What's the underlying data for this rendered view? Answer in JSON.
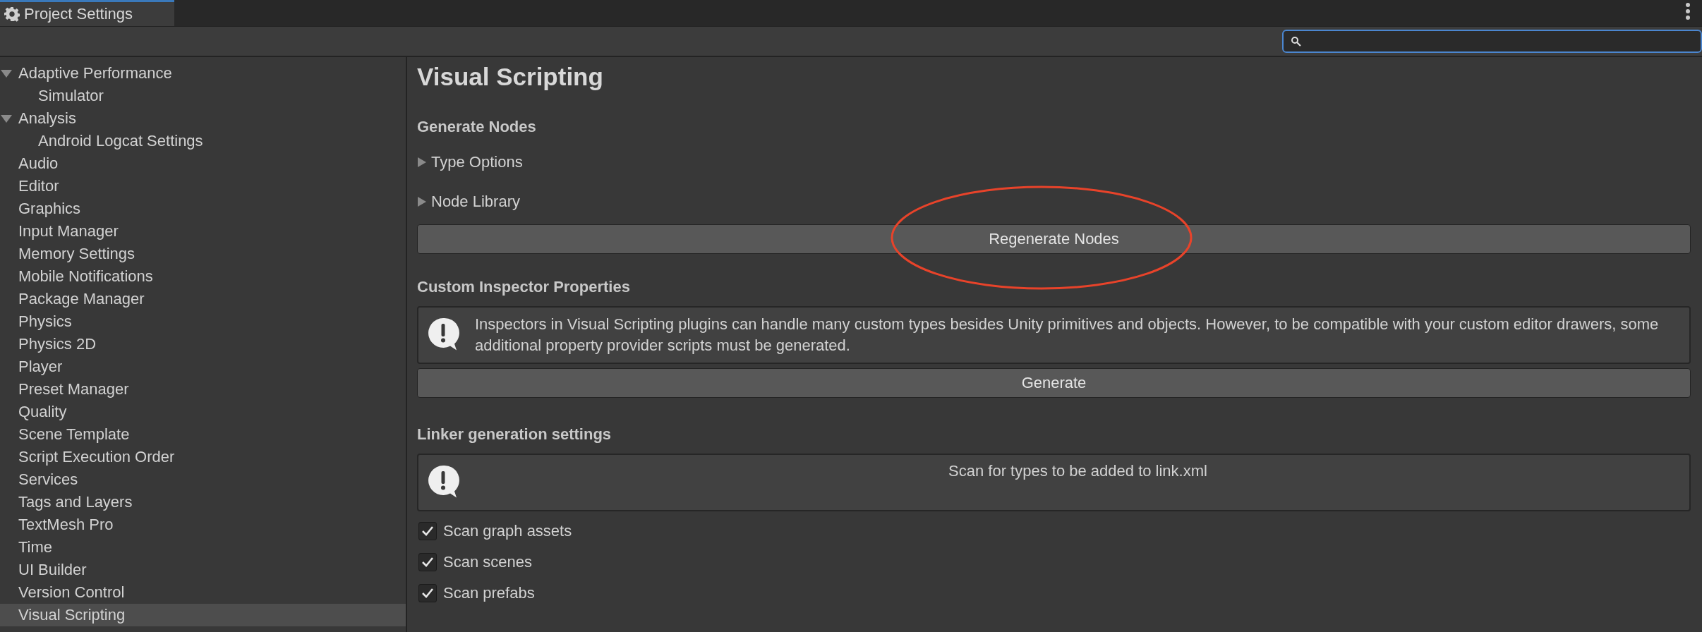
{
  "window": {
    "title": "Project Settings"
  },
  "search": {
    "focused": true
  },
  "sidebar": {
    "items": [
      {
        "label": "Adaptive Performance",
        "selected": false,
        "expanded": true,
        "children": [
          {
            "label": "Simulator",
            "selected": false
          }
        ]
      },
      {
        "label": "Analysis",
        "selected": false,
        "expanded": true,
        "children": [
          {
            "label": "Android Logcat Settings",
            "selected": false
          }
        ]
      },
      {
        "label": "Audio",
        "selected": false
      },
      {
        "label": "Editor",
        "selected": false
      },
      {
        "label": "Graphics",
        "selected": false
      },
      {
        "label": "Input Manager",
        "selected": false
      },
      {
        "label": "Memory Settings",
        "selected": false
      },
      {
        "label": "Mobile Notifications",
        "selected": false
      },
      {
        "label": "Package Manager",
        "selected": false
      },
      {
        "label": "Physics",
        "selected": false
      },
      {
        "label": "Physics 2D",
        "selected": false
      },
      {
        "label": "Player",
        "selected": false
      },
      {
        "label": "Preset Manager",
        "selected": false
      },
      {
        "label": "Quality",
        "selected": false
      },
      {
        "label": "Scene Template",
        "selected": false
      },
      {
        "label": "Script Execution Order",
        "selected": false
      },
      {
        "label": "Services",
        "selected": false
      },
      {
        "label": "Tags and Layers",
        "selected": false
      },
      {
        "label": "TextMesh Pro",
        "selected": false
      },
      {
        "label": "Time",
        "selected": false
      },
      {
        "label": "UI Builder",
        "selected": false
      },
      {
        "label": "Version Control",
        "selected": false
      },
      {
        "label": "Visual Scripting",
        "selected": true
      }
    ]
  },
  "panel": {
    "title": "Visual Scripting",
    "sections": [
      {
        "heading": "Generate Nodes",
        "items": [
          {
            "kind": "foldout",
            "label": "Type Options",
            "expanded": false
          },
          {
            "kind": "foldout",
            "label": "Node Library",
            "expanded": false
          },
          {
            "kind": "button",
            "label": "Regenerate Nodes",
            "highlighted": true
          }
        ]
      },
      {
        "heading": "Custom Inspector Properties",
        "items": [
          {
            "kind": "info",
            "text": "Inspectors in Visual Scripting plugins can handle many custom types besides Unity primitives and objects. However, to be compatible with your custom editor drawers, some additional property provider scripts must be generated."
          },
          {
            "kind": "button",
            "label": "Generate",
            "highlighted": false
          }
        ]
      },
      {
        "heading": "Linker generation settings",
        "items": [
          {
            "kind": "notice",
            "text": "Scan for types to be added to link.xml"
          },
          {
            "kind": "checkbox",
            "label": "Scan graph assets",
            "checked": true
          },
          {
            "kind": "checkbox",
            "label": "Scan scenes",
            "checked": true
          },
          {
            "kind": "checkbox",
            "label": "Scan prefabs",
            "checked": true
          }
        ]
      }
    ]
  }
}
